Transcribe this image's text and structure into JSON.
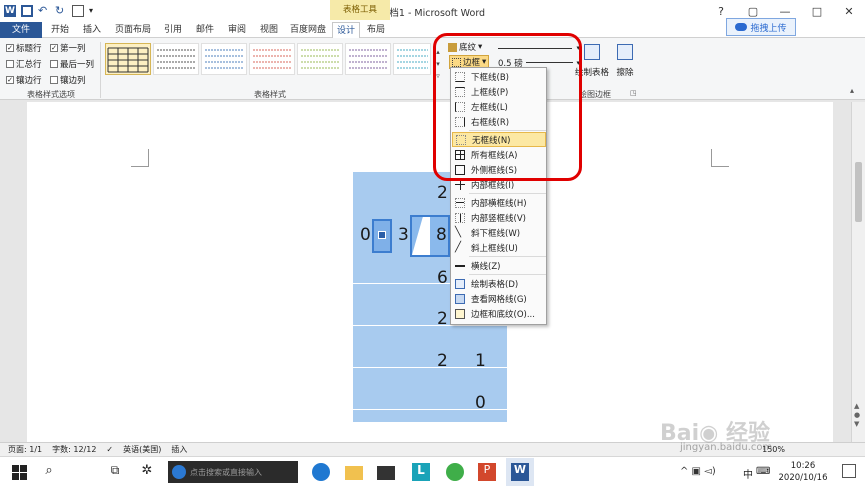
{
  "window": {
    "title": "文档1 - Microsoft Word",
    "tool_group": "表格工具",
    "controls": {
      "help": "?",
      "restore": "▢",
      "minimize": "—",
      "maximize": "□",
      "close": "✕"
    }
  },
  "tabs": {
    "file": "文件",
    "items": [
      {
        "label": "开始"
      },
      {
        "label": "插入"
      },
      {
        "label": "页面布局"
      },
      {
        "label": "引用"
      },
      {
        "label": "邮件"
      },
      {
        "label": "审阅"
      },
      {
        "label": "视图"
      },
      {
        "label": "百度网盘"
      },
      {
        "label": "设计"
      },
      {
        "label": "布局"
      }
    ],
    "upload": "拖拽上传"
  },
  "ribbon": {
    "table_style_options": {
      "label": "表格样式选项",
      "checks": [
        {
          "label": "标题行",
          "checked": true
        },
        {
          "label": "第一列",
          "checked": true
        },
        {
          "label": "汇总行",
          "checked": false
        },
        {
          "label": "最后一列",
          "checked": false
        },
        {
          "label": "镶边行",
          "checked": true
        },
        {
          "label": "镶边列",
          "checked": false
        }
      ]
    },
    "table_styles_label": "表格样式",
    "shading_label": "底纹",
    "borders_label": "边框",
    "pen_weight": "0.5 磅",
    "draw_table": "绘制表格",
    "eraser": "擦除",
    "draw_borders_label": "绘图边框"
  },
  "border_menu": {
    "items": [
      {
        "label": "下框线(B)",
        "icon": "border-bottom-icon"
      },
      {
        "label": "上框线(P)",
        "icon": "border-top-icon"
      },
      {
        "label": "左框线(L)",
        "icon": "border-left-icon"
      },
      {
        "label": "右框线(R)",
        "icon": "border-right-icon"
      },
      {
        "label": "无框线(N)",
        "icon": "border-none-icon",
        "highlighted": true
      },
      {
        "label": "所有框线(A)",
        "icon": "border-all-icon"
      },
      {
        "label": "外侧框线(S)",
        "icon": "border-outside-icon"
      },
      {
        "label": "内部框线(I)",
        "icon": "border-inside-icon"
      },
      {
        "label": "内部横框线(H)",
        "icon": "border-inside-horizontal-icon"
      },
      {
        "label": "内部竖框线(V)",
        "icon": "border-inside-vertical-icon"
      },
      {
        "label": "斜下框线(W)",
        "icon": "diagonal-down-icon"
      },
      {
        "label": "斜上框线(U)",
        "icon": "diagonal-up-icon"
      },
      {
        "label": "横线(Z)",
        "icon": "horizontal-line-icon"
      },
      {
        "label": "绘制表格(D)",
        "icon": "draw-table-icon"
      },
      {
        "label": "查看网格线(G)",
        "icon": "gridlines-icon"
      },
      {
        "label": "边框和底纹(O)...",
        "icon": "borders-shading-icon"
      }
    ]
  },
  "document": {
    "numbers": [
      "2",
      "0",
      "3",
      "8",
      "6",
      "2",
      "1",
      "2",
      "1",
      "0"
    ]
  },
  "status_bar": {
    "page": "页面: 1/1",
    "words": "字数: 12/12",
    "language": "英语(美国)",
    "mode": "插入",
    "zoom": "150%"
  },
  "taskbar": {
    "search_placeholder": "点击搜索或直接输入",
    "tray_text": "中",
    "time": "10:26",
    "date": "2020/10/16"
  },
  "watermark": "jingyan.baidu.com",
  "colors": {
    "accent": "#2b5797",
    "table_fill": "#a8cbef",
    "highlight": "#fce8a3",
    "annotation_red": "#e00000"
  }
}
